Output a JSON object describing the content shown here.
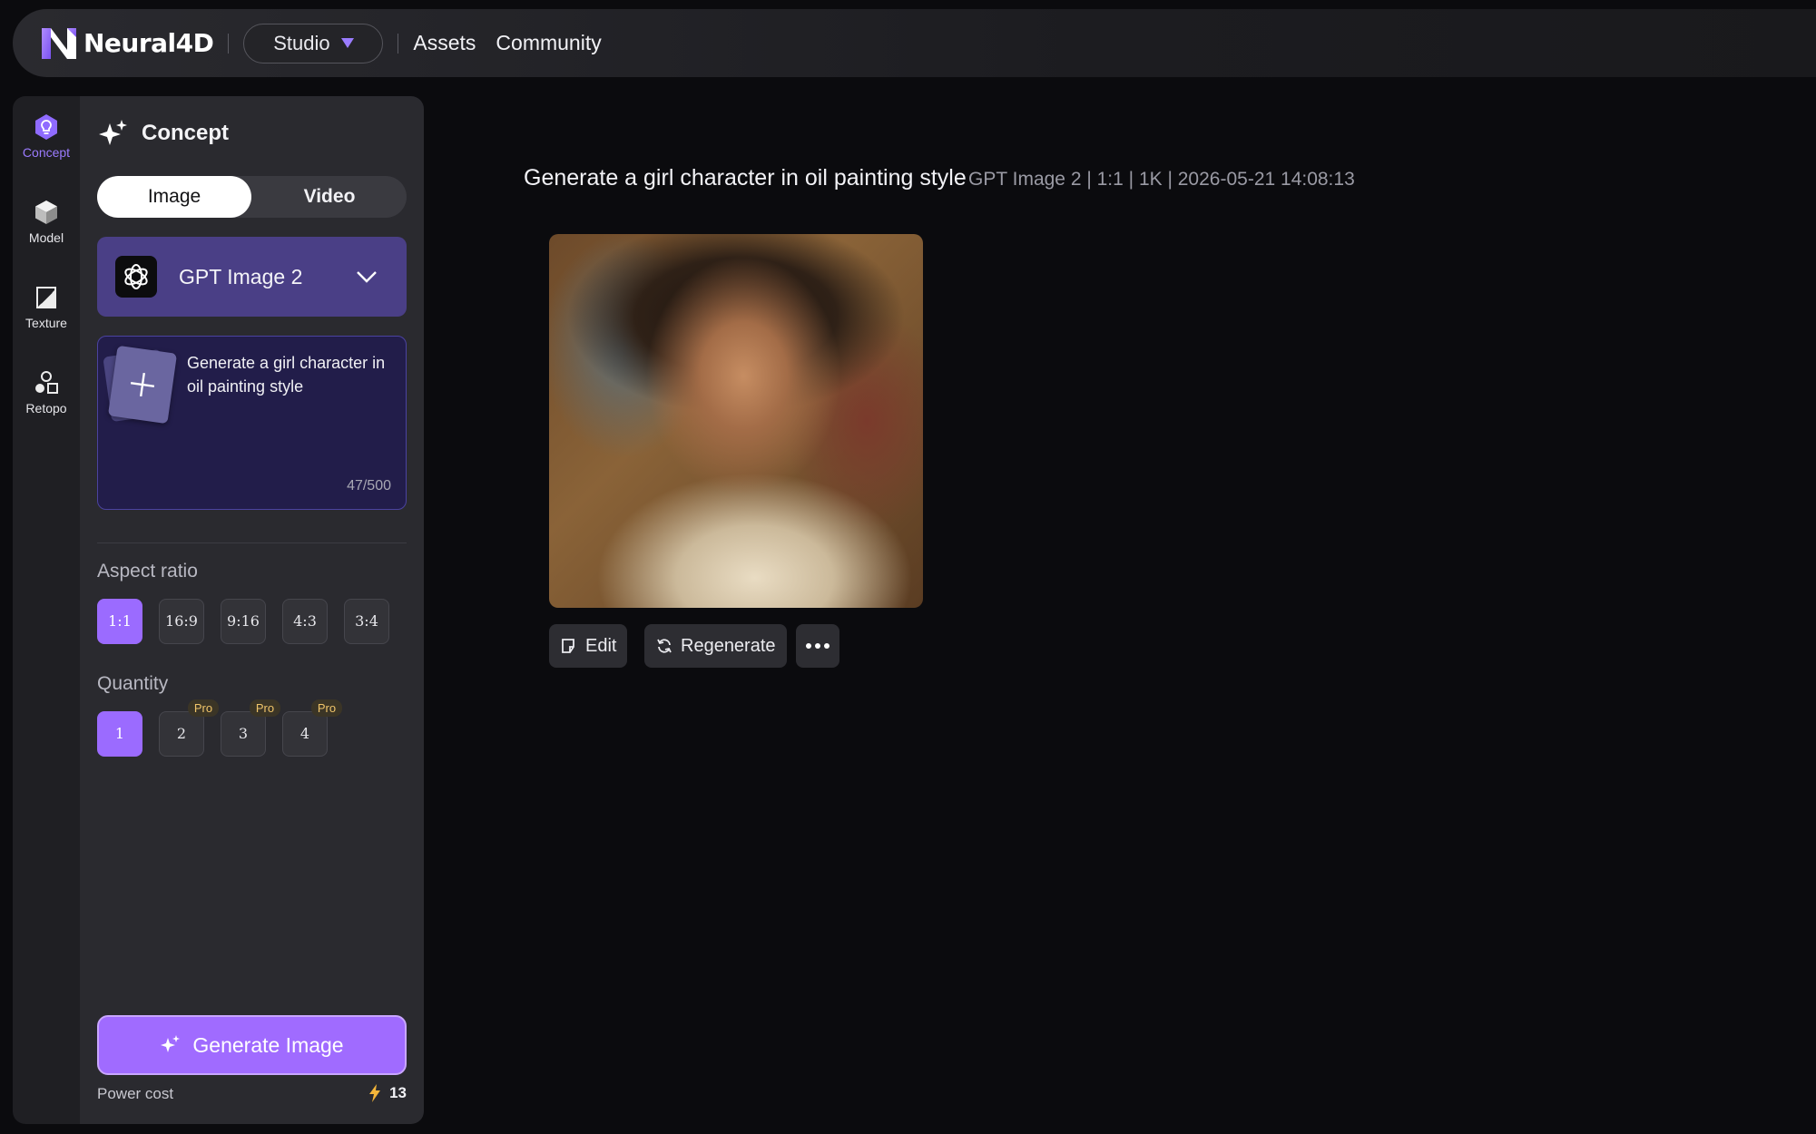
{
  "header": {
    "logo_text": "Neural4D",
    "studio_label": "Studio",
    "nav": [
      "Assets",
      "Community"
    ]
  },
  "rail": [
    {
      "label": "Concept",
      "icon": "concept-icon",
      "active": true
    },
    {
      "label": "Model",
      "icon": "cube-icon",
      "active": false
    },
    {
      "label": "Texture",
      "icon": "texture-icon",
      "active": false
    },
    {
      "label": "Retopo",
      "icon": "retopo-icon",
      "active": false
    }
  ],
  "panel": {
    "title": "Concept",
    "tabs": {
      "image": "Image",
      "video": "Video"
    },
    "model": {
      "name": "GPT Image 2",
      "icon": "openai-icon"
    },
    "prompt": {
      "text": "Generate a girl character in oil painting style",
      "counter": "47/500"
    },
    "aspect_label": "Aspect ratio",
    "aspect_options": [
      "1:1",
      "16:9",
      "9:16",
      "4:3",
      "3:4"
    ],
    "aspect_selected": "1:1",
    "quantity_label": "Quantity",
    "quantity_options": [
      "1",
      "2",
      "3",
      "4"
    ],
    "quantity_selected": "1",
    "pro_label": "Pro",
    "generate_label": "Generate Image",
    "power_cost_label": "Power cost",
    "power_cost_value": "13"
  },
  "result": {
    "prompt": "Generate a girl character in oil painting style",
    "meta": "GPT Image 2 | 1:1 | 1K | 2026-05-21 14:08:13",
    "actions": {
      "edit": "Edit",
      "regenerate": "Regenerate"
    }
  },
  "colors": {
    "accent": "#9b6bff",
    "panel": "#2a2a2f",
    "model_bg": "#4a3f86",
    "pro_text": "#f0c56a"
  }
}
